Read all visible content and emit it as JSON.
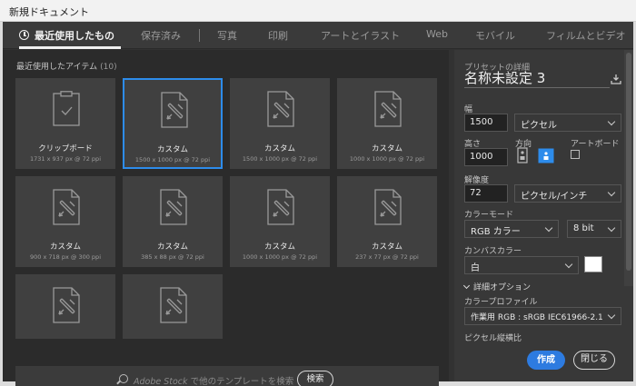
{
  "window": {
    "title": "新規ドキュメント"
  },
  "tabs": [
    {
      "label": "最近使用したもの",
      "active": true
    },
    {
      "label": "保存済み"
    },
    {
      "label": "写真"
    },
    {
      "label": "印刷"
    },
    {
      "label": "アートとイラスト"
    },
    {
      "label": "Web"
    },
    {
      "label": "モバイル"
    },
    {
      "label": "フィルムとビデオ"
    }
  ],
  "recent": {
    "title": "最近使用したアイテム",
    "count": "(10)",
    "items": [
      {
        "label": "クリップボード",
        "sub": "1731 x 937 px @ 72 ppi",
        "icon": "clipboard-icon"
      },
      {
        "label": "カスタム",
        "sub": "1500 x 1000 px @ 72 ppi",
        "icon": "custom-document-icon",
        "selected": true
      },
      {
        "label": "カスタム",
        "sub": "1500 x 1000 px @ 72 ppi",
        "icon": "custom-document-icon"
      },
      {
        "label": "カスタム",
        "sub": "1000 x 1000 px @ 72 ppi",
        "icon": "custom-document-icon"
      },
      {
        "label": "カスタム",
        "sub": "900 x 718 px @ 300 ppi",
        "icon": "custom-document-icon"
      },
      {
        "label": "カスタム",
        "sub": "385 x 88 px @ 72 ppi",
        "icon": "custom-document-icon"
      },
      {
        "label": "カスタム",
        "sub": "1000 x 1000 px @ 72 ppi",
        "icon": "custom-document-icon"
      },
      {
        "label": "カスタム",
        "sub": "237 x 77 px @ 72 ppi",
        "icon": "custom-document-icon"
      },
      {
        "label": "",
        "sub": "",
        "icon": "custom-document-icon"
      },
      {
        "label": "",
        "sub": "",
        "icon": "custom-document-icon"
      }
    ]
  },
  "search": {
    "brand": "Adobe Stock",
    "placeholder": "で他のテンプレートを検索",
    "button": "検索"
  },
  "preset": {
    "heading": "プリセットの詳細",
    "name": "名称未設定 3",
    "width_label": "幅",
    "width_value": "1500",
    "width_unit": "ピクセル",
    "height_label": "高さ",
    "height_value": "1000",
    "orientation_label": "方向",
    "artboard_label": "アートボード",
    "resolution_label": "解像度",
    "resolution_value": "72",
    "resolution_unit": "ピクセル/インチ",
    "color_mode_label": "カラーモード",
    "color_mode_value": "RGB カラー",
    "bit_depth_value": "8 bit",
    "canvas_color_label": "カンバスカラー",
    "canvas_color_value": "白",
    "advanced_label": "詳細オプション",
    "color_profile_label": "カラープロファイル",
    "color_profile_value": "作業用 RGB : sRGB IEC61966-2.1",
    "pixel_aspect_label": "ピクセル縦横比"
  },
  "actions": {
    "create": "作成",
    "close": "閉じる"
  },
  "colors": {
    "accent": "#2d7be0",
    "panel": "#383838",
    "left_panel": "#2b2b2b",
    "card": "#404040"
  }
}
